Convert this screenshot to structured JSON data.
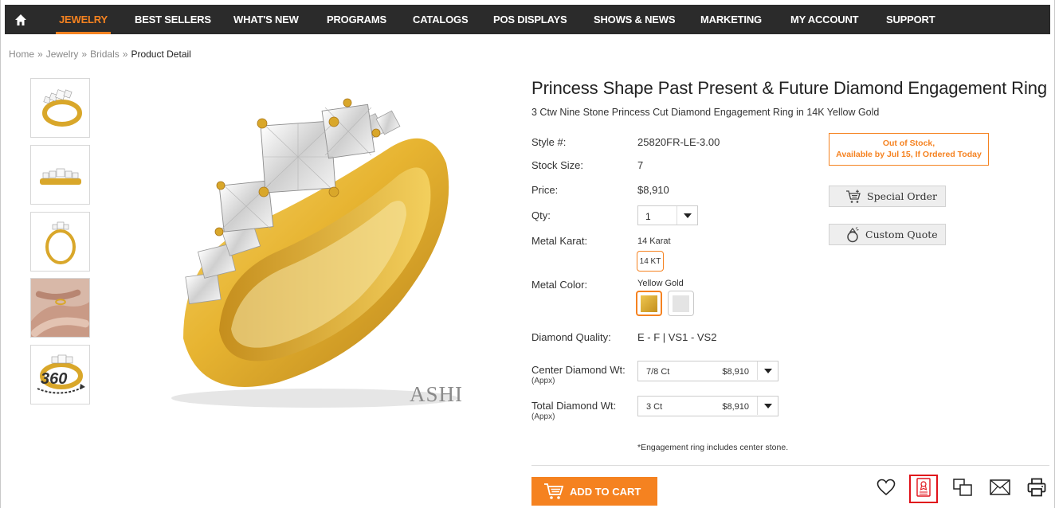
{
  "nav": {
    "items": [
      {
        "label": "JEWELRY",
        "active": true
      },
      {
        "label": "BEST SELLERS"
      },
      {
        "label": "WHAT'S NEW"
      },
      {
        "label": "PROGRAMS"
      },
      {
        "label": "CATALOGS"
      },
      {
        "label": "POS DISPLAYS"
      },
      {
        "label": "SHOWS & NEWS"
      },
      {
        "label": "MARKETING"
      },
      {
        "label": "MY ACCOUNT"
      },
      {
        "label": "SUPPORT"
      }
    ]
  },
  "breadcrumb": {
    "items": [
      "Home",
      "Jewelry",
      "Bridals"
    ],
    "separator": "»",
    "current": "Product Detail"
  },
  "watermark": "ASHI",
  "product": {
    "title": "Princess Shape Past Present & Future Diamond Engagement Ring",
    "subtitle": "3 Ctw Nine Stone Princess Cut Diamond Engagement Ring in 14K Yellow Gold",
    "style_label": "Style #:",
    "style_value": "25820FR-LE-3.00",
    "stock_size_label": "Stock Size:",
    "stock_size_value": "7",
    "price_label": "Price:",
    "price_value": "$8,910",
    "qty_label": "Qty:",
    "qty_value": "1",
    "metal_karat_label": "Metal Karat:",
    "metal_karat_value": "14 Karat",
    "karat_option": "14 KT",
    "metal_color_label": "Metal Color:",
    "metal_color_value": "Yellow Gold",
    "colors": {
      "yellow": "#d9a72a",
      "white": "#e4e4e4"
    },
    "diamond_quality_label": "Diamond Quality:",
    "diamond_quality_value": "E - F | VS1 - VS2",
    "center_wt_label": "Center Diamond Wt:",
    "center_wt_note": "(Appx)",
    "center_wt_value": "7/8 Ct",
    "center_wt_price": "$8,910",
    "total_wt_label": "Total Diamond Wt:",
    "total_wt_note": "(Appx)",
    "total_wt_value": "3 Ct",
    "total_wt_price": "$8,910",
    "note": "*Engagement ring includes center stone."
  },
  "stock_status": {
    "line1": "Out of Stock,",
    "line2": "Available by Jul 15, If Ordered Today"
  },
  "actions": {
    "special_order": "Special Order",
    "custom_quote": "Custom Quote",
    "add_to_cart": "ADD TO CART"
  },
  "toolbar_icons": [
    "heart-icon",
    "certificate-icon",
    "compare-icon",
    "email-icon",
    "print-icon"
  ],
  "colors": {
    "accent": "#f58220",
    "nav_bg": "#2b2b2b",
    "highlight": "#e0121b"
  }
}
